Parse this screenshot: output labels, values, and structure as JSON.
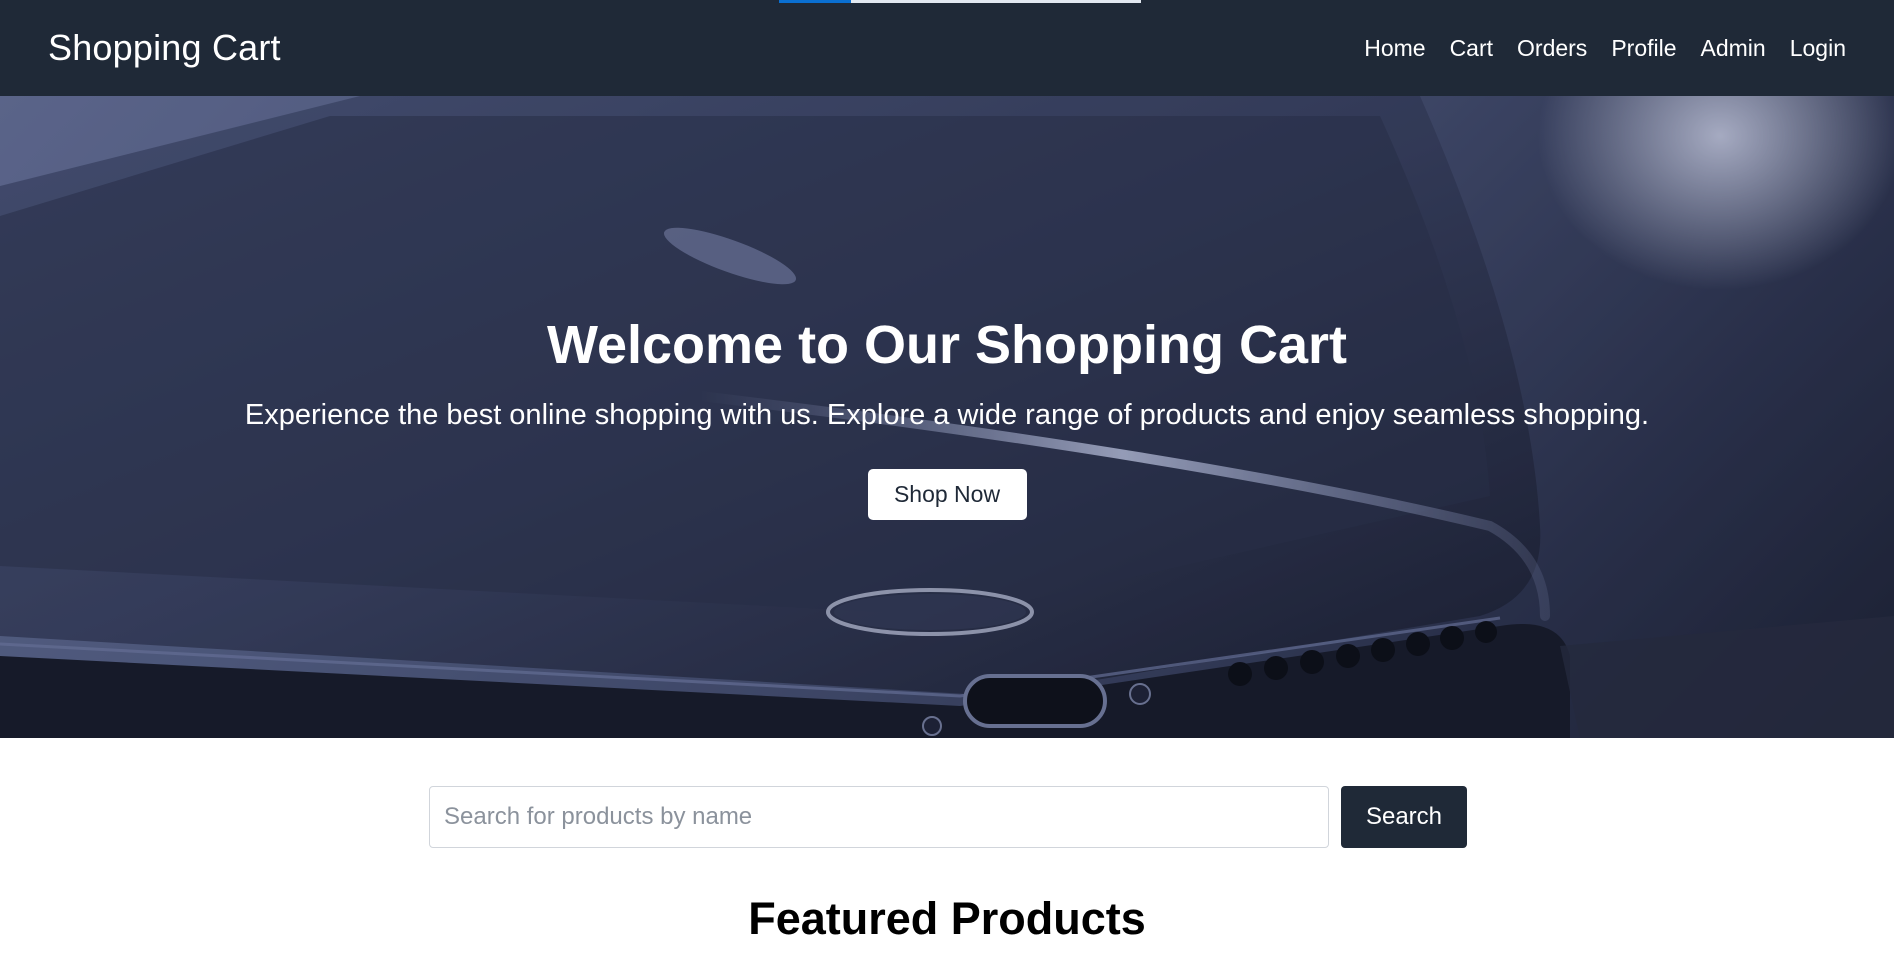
{
  "top_progress": {
    "fraction": 0.2
  },
  "navbar": {
    "brand": "Shopping Cart",
    "links": [
      "Home",
      "Cart",
      "Orders",
      "Profile",
      "Admin",
      "Login"
    ]
  },
  "hero": {
    "title": "Welcome to Our Shopping Cart",
    "subtitle": "Experience the best online shopping with us. Explore a wide range of products and enjoy seamless shopping.",
    "cta_label": "Shop Now",
    "image": "smartphone-closeup"
  },
  "search": {
    "placeholder": "Search for products by name",
    "value": "",
    "button_label": "Search"
  },
  "featured": {
    "title": "Featured Products"
  },
  "colors": {
    "navbar_bg": "#1f2937",
    "accent": "#0a6fd1",
    "button_dark": "#1f2937",
    "white": "#ffffff"
  }
}
